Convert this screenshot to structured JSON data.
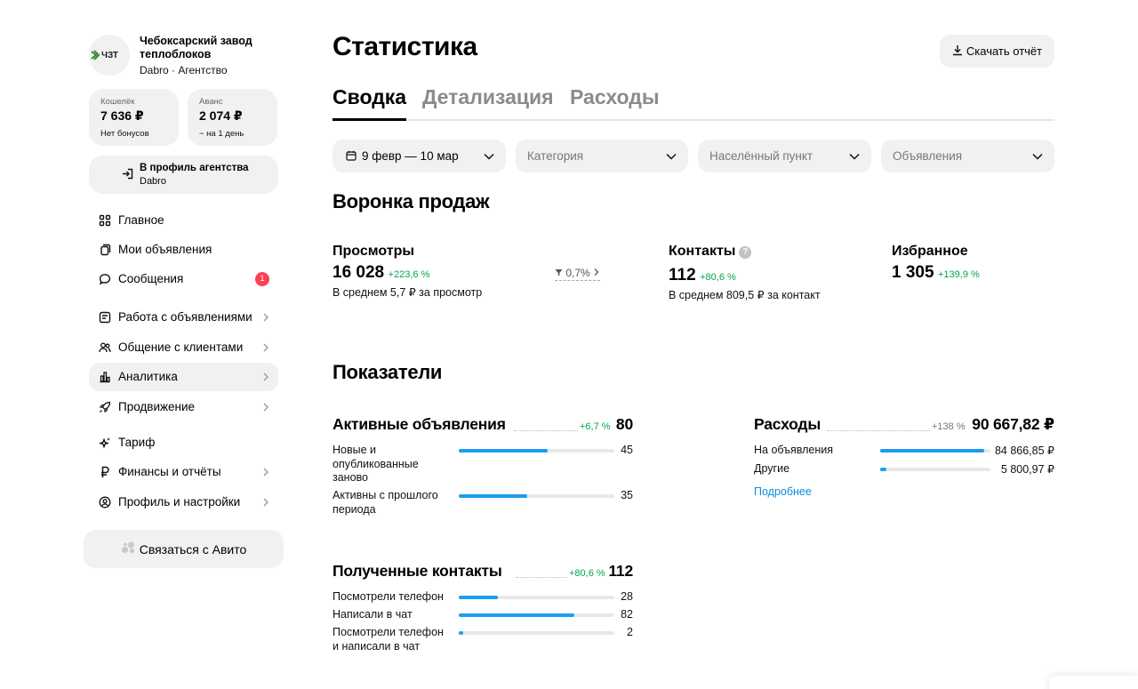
{
  "sidebar": {
    "org_name": "Чебоксарский завод теплоблоков",
    "org_sub": "Dabro · Агентство",
    "logo_text": "ЧЗТ",
    "wallet": {
      "label": "Кошелёк",
      "value": "7 636 ₽",
      "sub": "Нет бонусов"
    },
    "advance": {
      "label": "Аванс",
      "value": "2 074 ₽",
      "sub": "~ на 1 день"
    },
    "agency_link": {
      "title": "В профиль агентства",
      "sub": "Dabro"
    },
    "nav": [
      {
        "label": "Главное",
        "icon": "grid-icon"
      },
      {
        "label": "Мои объявления",
        "icon": "copy-icon"
      },
      {
        "label": "Сообщения",
        "icon": "chat-icon",
        "badge": "1"
      },
      {
        "label": "Работа с объявлениями",
        "icon": "list-icon"
      },
      {
        "label": "Общение с клиентами",
        "icon": "users-icon"
      },
      {
        "label": "Аналитика",
        "icon": "bar-chart-icon",
        "active": true
      },
      {
        "label": "Продвижение",
        "icon": "rocket-icon"
      },
      {
        "label": "Тариф",
        "icon": "sparkle-icon"
      },
      {
        "label": "Финансы и отчёты",
        "icon": "ruble-icon"
      },
      {
        "label": "Профиль и настройки",
        "icon": "user-circle-icon"
      }
    ],
    "contact_avito": "Связаться с Авито"
  },
  "header": {
    "title": "Статистика",
    "download_label": "Скачать отчёт"
  },
  "tabs": [
    {
      "label": "Сводка",
      "active": true
    },
    {
      "label": "Детализация"
    },
    {
      "label": "Расходы"
    }
  ],
  "filters": {
    "date": "9 февр — 10 мар",
    "category": "Категория",
    "locality": "Населённый пункт",
    "ads": "Объявления"
  },
  "funnel": {
    "title": "Воронка продаж",
    "views": {
      "label": "Просмотры",
      "value": "16 028",
      "delta": "+223,6 %",
      "note": "В среднем 5,7 ₽ за просмотр"
    },
    "conversion": "0,7%",
    "contacts": {
      "label": "Контакты",
      "value": "112",
      "delta": "+80,6 %",
      "note": "В среднем 809,5 ₽ за контакт",
      "help": "?"
    },
    "favorites": {
      "label": "Избранное",
      "value": "1 305",
      "delta": "+139,9 %"
    }
  },
  "indicators": {
    "title": "Показатели",
    "active_ads": {
      "title": "Активные объявления",
      "delta": "+6,7 %",
      "total": "80",
      "rows": [
        {
          "label": "Новые и опубликованные заново",
          "value": "45",
          "share": 0.57
        },
        {
          "label": "Активны с прошлого периода",
          "value": "35",
          "share": 0.44
        }
      ]
    },
    "expenses": {
      "title": "Расходы",
      "delta": "+138 %",
      "total": "90 667,82 ₽",
      "rows": [
        {
          "label": "На объявления",
          "value": "84 866,85 ₽",
          "share": 0.94
        },
        {
          "label": "Другие",
          "value": "5 800,97 ₽",
          "share": 0.06
        }
      ],
      "more_link": "Подробнее"
    },
    "contacts_received": {
      "title": "Полученные контакты",
      "delta": "+80,6 %",
      "total": "112",
      "rows": [
        {
          "label": "Посмотрели телефон",
          "value": "28",
          "share": 0.25
        },
        {
          "label": "Написали в чат",
          "value": "82",
          "share": 0.74
        },
        {
          "label": "Посмотрели телефон и написали в чат",
          "value": "2",
          "share": 0.03
        }
      ]
    }
  },
  "colors": {
    "accent": "#1c9cf0",
    "positive": "#02a650",
    "badge": "#ff4053",
    "card_bg": "#f2f1ef",
    "link": "#0a8ed9"
  }
}
